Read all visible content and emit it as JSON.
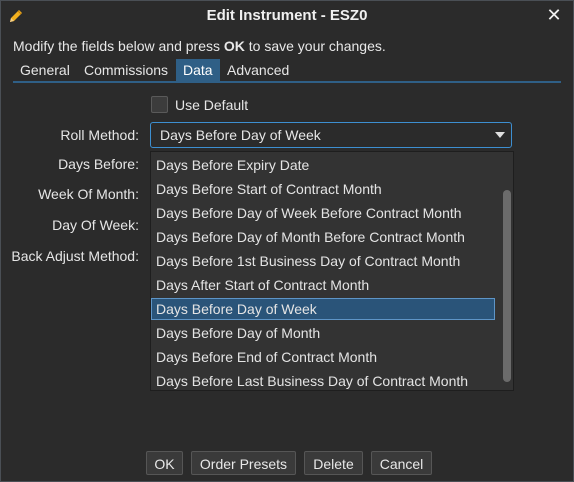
{
  "window": {
    "title": "Edit Instrument - ESZ0",
    "close_icon": "close-icon",
    "title_icon": "pencil-icon"
  },
  "instructions": {
    "prefix": "Modify the fields below and press ",
    "bold": "OK",
    "suffix": " to save your changes."
  },
  "tabs": [
    {
      "label": "General",
      "active": false
    },
    {
      "label": "Commissions",
      "active": false
    },
    {
      "label": "Data",
      "active": true
    },
    {
      "label": "Advanced",
      "active": false
    }
  ],
  "form": {
    "use_default_label": "Use Default",
    "use_default_checked": false,
    "roll_method_label": "Roll Method:",
    "roll_method_value": "Days Before Day of Week",
    "days_before_label": "Days Before:",
    "week_of_month_label": "Week Of Month:",
    "day_of_week_label": "Day Of Week:",
    "back_adjust_label": "Back Adjust Method:"
  },
  "dropdown": {
    "options": [
      "Days Before Expiry Date",
      "Days Before Start of Contract Month",
      "Days Before Day of Week Before Contract Month",
      "Days Before Day of Month Before Contract Month",
      "Days Before 1st Business Day of Contract Month",
      "Days After Start of Contract Month",
      "Days Before Day of Week",
      "Days Before Day of Month",
      "Days Before End of Contract Month",
      "Days Before Last Business Day of Contract Month"
    ],
    "selected_index": 6
  },
  "buttons": {
    "ok": "OK",
    "order_presets": "Order Presets",
    "delete": "Delete",
    "cancel": "Cancel"
  },
  "colors": {
    "background": "#2b2b2b",
    "accent": "#2f5f86",
    "focus_border": "#3d8fd1"
  }
}
